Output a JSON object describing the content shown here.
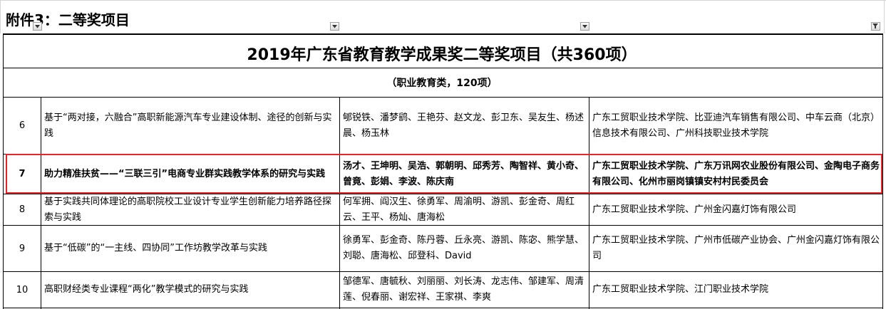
{
  "sheet": {
    "header_title": "附件3：二等奖项目",
    "filter_icons": [
      "filter-dropdown-icon",
      "filter-dropdown-icon",
      "filter-dropdown-icon",
      "filter-active-icon"
    ]
  },
  "table": {
    "title": "2019年广东省教育教学成果奖二等奖项目（共360项）",
    "subtitle": "（职业教育类，120项）",
    "rows": [
      {
        "no": "6",
        "project": "基于“两对接，六融合”高职新能源汽车专业建设体制、途径的创新与实践",
        "members": "郇锐铁、潘梦鹞、王艳芬、赵文龙、彭卫东、吴友生、杨述晨、杨玉林",
        "units": "广东工贸职业技术学院、比亚迪汽车销售有限公司、中车云商（北京）信息技术有限公司、广州科技职业技术学院"
      },
      {
        "no": "7",
        "project": "助力精准扶贫——“三联三引”电商专业群实践教学体系的研究与实践",
        "members": "汤才、王坤明、吴浩、郭朝明、邱秀芳、陶智祥、黄小奇、曾竟、彭娟、李波、陈庆南",
        "units": "广东工贸职业技术学院、广东万讯网农业股份有限公司、金陶电子商务有限公司、化州市丽岗镇镇安村村民委员会"
      },
      {
        "no": "8",
        "project": "基于实践共同体理论的高职院校工业设计专业学生创新能力培养路径探索与实践",
        "members": "何军拥、阎汉生、徐勇军、周渝明、游凯、彭金奇、周红云、王平、杨灿、唐海松",
        "units": "广东工贸职业技术学院、广州金闪嘉灯饰有限公司"
      },
      {
        "no": "9",
        "project": "基于“低碳”的“一主线、四协同”工作坊教学改革与实践",
        "members": "徐勇军、彭金奇、陈丹蓉、丘永亮、游凯、陈宓、熊学慧、刘聪、唐海松、邱登科、David",
        "units": "广东工贸职业技术学院、广州市低碳产业协会、广州金闪嘉灯饰有限公司"
      },
      {
        "no": "10",
        "project": "高职财经类专业课程“两化”教学模式的研究与实践",
        "members": "邹德军、唐毓秋、刘丽丽、刘长涛、龙志伟、邹建军、周清莲、倪春丽、谢宏祥、王家祺、李爽",
        "units": "广东工贸职业技术学院、江门职业技术学院"
      }
    ]
  },
  "colors": {
    "highlight_border": "#e8252a",
    "grid_line": "#000000"
  }
}
